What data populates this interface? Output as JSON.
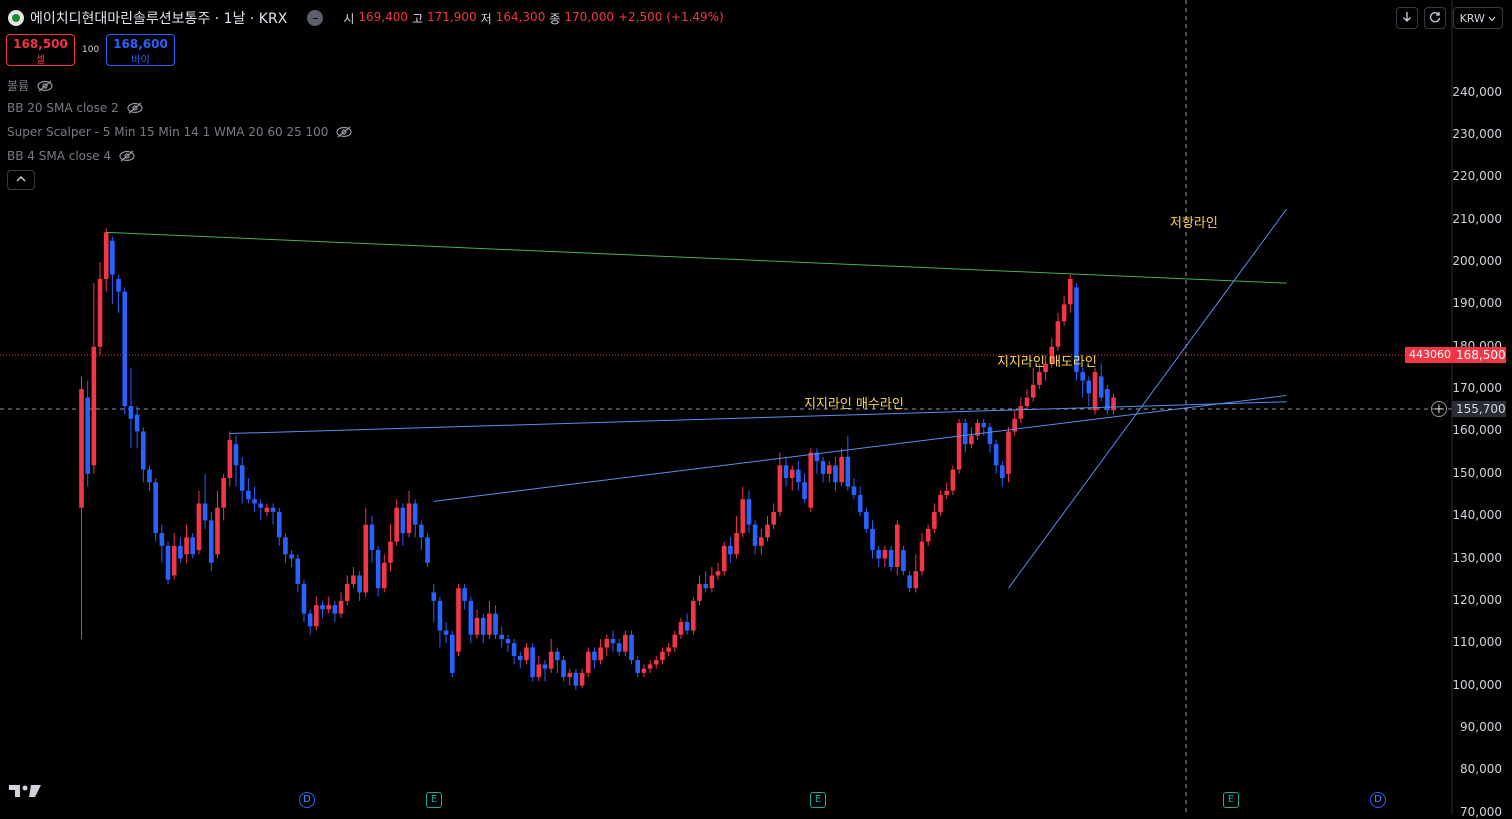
{
  "header": {
    "title": "에이치디현대마린솔루션보통주 · 1날 · KRX",
    "ohlc": [
      {
        "k": "시",
        "v": "169,400"
      },
      {
        "k": "고",
        "v": "171,900"
      },
      {
        "k": "저",
        "v": "164,300"
      },
      {
        "k": "종",
        "v": "170,000"
      },
      {
        "k": "",
        "v": "+2,500 (+1.49%)"
      }
    ]
  },
  "trade": {
    "sell_price": "168,500",
    "sell_label": "셀",
    "qty": "100",
    "buy_price": "168,600",
    "buy_label": "바이"
  },
  "indicators": [
    {
      "label": "볼륨"
    },
    {
      "label": "BB 20 SMA close 2"
    },
    {
      "label": "Super Scalper - 5 Min 15 Min 14 1 WMA 20 60 25 100"
    },
    {
      "label": "BB 4 SMA close 4"
    }
  ],
  "toolbar": {
    "currency": "KRW"
  },
  "axis": {
    "labels": [
      "240,000",
      "230,000",
      "220,000",
      "210,000",
      "200,000",
      "190,000",
      "180,000",
      "170,000",
      "160,000",
      "150,000",
      "140,000",
      "130,000",
      "120,000",
      "110,000",
      "100,000",
      "90,000",
      "80,000",
      "70,000"
    ],
    "current_price": "168,500",
    "countdown": "443060",
    "crosshair_price": "155,700"
  },
  "annotations": {
    "resistance": "저항라인",
    "support_sell": "지지라인 매도라인",
    "support_buy": "지지라인 매수라인"
  },
  "events": [
    {
      "type": "D",
      "label": "D"
    },
    {
      "type": "E",
      "label": "E"
    },
    {
      "type": "E",
      "label": "E"
    },
    {
      "type": "E",
      "label": "E"
    },
    {
      "type": "D",
      "label": "D"
    }
  ],
  "colors": {
    "up": "#f23645",
    "down": "#2962ff",
    "resistance_line": "#4caf50",
    "trend_line": "#5b8def",
    "annotation": "#ffd54f"
  },
  "chart_data": {
    "type": "candlestick",
    "ylim": [
      65000,
      245000
    ],
    "candles": [
      {
        "o": 142000,
        "c": 170000,
        "h": 173000,
        "l": 111000
      },
      {
        "o": 168000,
        "c": 150000,
        "h": 172000,
        "l": 147000
      },
      {
        "o": 152000,
        "c": 180000,
        "h": 195000,
        "l": 150000
      },
      {
        "o": 180000,
        "c": 196000,
        "h": 200000,
        "l": 178000
      },
      {
        "o": 196000,
        "c": 207000,
        "h": 208000,
        "l": 193000
      },
      {
        "o": 205000,
        "c": 197000,
        "h": 206000,
        "l": 190000
      },
      {
        "o": 196000,
        "c": 193000,
        "h": 197000,
        "l": 188000
      },
      {
        "o": 193000,
        "c": 166000,
        "h": 194000,
        "l": 164000
      },
      {
        "o": 166000,
        "c": 163000,
        "h": 175000,
        "l": 156000
      },
      {
        "o": 164000,
        "c": 160000,
        "h": 166000,
        "l": 156000
      },
      {
        "o": 160000,
        "c": 151000,
        "h": 161000,
        "l": 148000
      },
      {
        "o": 151000,
        "c": 148000,
        "h": 152000,
        "l": 146000
      },
      {
        "o": 148000,
        "c": 136000,
        "h": 149000,
        "l": 134000
      },
      {
        "o": 136000,
        "c": 133000,
        "h": 138000,
        "l": 129000
      },
      {
        "o": 133000,
        "c": 125000,
        "h": 134000,
        "l": 124000
      },
      {
        "o": 126000,
        "c": 133000,
        "h": 136000,
        "l": 125000
      },
      {
        "o": 133000,
        "c": 130000,
        "h": 135000,
        "l": 129000
      },
      {
        "o": 131000,
        "c": 135000,
        "h": 138000,
        "l": 129000
      },
      {
        "o": 135000,
        "c": 131000,
        "h": 136000,
        "l": 130000
      },
      {
        "o": 132000,
        "c": 143000,
        "h": 146000,
        "l": 131000
      },
      {
        "o": 143000,
        "c": 139000,
        "h": 150000,
        "l": 137000
      },
      {
        "o": 139000,
        "c": 129000,
        "h": 141000,
        "l": 127000
      },
      {
        "o": 131000,
        "c": 142000,
        "h": 146000,
        "l": 130000
      },
      {
        "o": 142000,
        "c": 149000,
        "h": 150000,
        "l": 139000
      },
      {
        "o": 149000,
        "c": 158000,
        "h": 160000,
        "l": 147000
      },
      {
        "o": 157000,
        "c": 152000,
        "h": 159000,
        "l": 147000
      },
      {
        "o": 152000,
        "c": 146000,
        "h": 154000,
        "l": 143000
      },
      {
        "o": 146000,
        "c": 144000,
        "h": 149000,
        "l": 143000
      },
      {
        "o": 144000,
        "c": 143000,
        "h": 147000,
        "l": 141000
      },
      {
        "o": 143000,
        "c": 142000,
        "h": 144000,
        "l": 139000
      },
      {
        "o": 141000,
        "c": 142000,
        "h": 143000,
        "l": 140000
      },
      {
        "o": 142000,
        "c": 141000,
        "h": 143000,
        "l": 138000
      },
      {
        "o": 141000,
        "c": 135000,
        "h": 142000,
        "l": 133000
      },
      {
        "o": 135000,
        "c": 131000,
        "h": 136000,
        "l": 129000
      },
      {
        "o": 131000,
        "c": 130000,
        "h": 132000,
        "l": 128000
      },
      {
        "o": 130000,
        "c": 124000,
        "h": 131000,
        "l": 122000
      },
      {
        "o": 124000,
        "c": 117000,
        "h": 125000,
        "l": 115000
      },
      {
        "o": 117000,
        "c": 114000,
        "h": 118000,
        "l": 112000
      },
      {
        "o": 114000,
        "c": 119000,
        "h": 121000,
        "l": 113000
      },
      {
        "o": 119000,
        "c": 118000,
        "h": 120000,
        "l": 116000
      },
      {
        "o": 118000,
        "c": 119000,
        "h": 121000,
        "l": 117000
      },
      {
        "o": 119000,
        "c": 117000,
        "h": 120000,
        "l": 115000
      },
      {
        "o": 117000,
        "c": 120000,
        "h": 122000,
        "l": 116000
      },
      {
        "o": 120000,
        "c": 124000,
        "h": 126000,
        "l": 119000
      },
      {
        "o": 124000,
        "c": 126000,
        "h": 128000,
        "l": 123000
      },
      {
        "o": 126000,
        "c": 122000,
        "h": 127000,
        "l": 120000
      },
      {
        "o": 122000,
        "c": 138000,
        "h": 142000,
        "l": 121000
      },
      {
        "o": 138000,
        "c": 132000,
        "h": 140000,
        "l": 129000
      },
      {
        "o": 132000,
        "c": 123000,
        "h": 133000,
        "l": 121000
      },
      {
        "o": 123000,
        "c": 129000,
        "h": 131000,
        "l": 122000
      },
      {
        "o": 129000,
        "c": 134000,
        "h": 138000,
        "l": 127000
      },
      {
        "o": 134000,
        "c": 142000,
        "h": 144000,
        "l": 133000
      },
      {
        "o": 142000,
        "c": 136000,
        "h": 143000,
        "l": 133000
      },
      {
        "o": 136000,
        "c": 143000,
        "h": 146000,
        "l": 135000
      },
      {
        "o": 143000,
        "c": 138000,
        "h": 144000,
        "l": 135000
      },
      {
        "o": 138000,
        "c": 135000,
        "h": 139000,
        "l": 132000
      },
      {
        "o": 135000,
        "c": 129000,
        "h": 136000,
        "l": 128000
      },
      {
        "o": 122000,
        "c": 120000,
        "h": 124000,
        "l": 115000
      },
      {
        "o": 120000,
        "c": 113000,
        "h": 121000,
        "l": 109000
      },
      {
        "o": 113000,
        "c": 112000,
        "h": 115000,
        "l": 110000
      },
      {
        "o": 112000,
        "c": 103000,
        "h": 113000,
        "l": 102000
      },
      {
        "o": 108000,
        "c": 123000,
        "h": 124000,
        "l": 107000
      },
      {
        "o": 123000,
        "c": 120000,
        "h": 124000,
        "l": 118000
      },
      {
        "o": 120000,
        "c": 112000,
        "h": 121000,
        "l": 110000
      },
      {
        "o": 112000,
        "c": 116000,
        "h": 118000,
        "l": 111000
      },
      {
        "o": 116000,
        "c": 112000,
        "h": 117000,
        "l": 110000
      },
      {
        "o": 112000,
        "c": 117000,
        "h": 120000,
        "l": 111000
      },
      {
        "o": 117000,
        "c": 112000,
        "h": 119000,
        "l": 111000
      },
      {
        "o": 112000,
        "c": 111000,
        "h": 114000,
        "l": 109000
      },
      {
        "o": 111000,
        "c": 110000,
        "h": 112000,
        "l": 108000
      },
      {
        "o": 110000,
        "c": 107000,
        "h": 111000,
        "l": 105000
      },
      {
        "o": 107000,
        "c": 106000,
        "h": 108000,
        "l": 104000
      },
      {
        "o": 106000,
        "c": 109000,
        "h": 110000,
        "l": 105000
      },
      {
        "o": 109000,
        "c": 102000,
        "h": 110000,
        "l": 101000
      },
      {
        "o": 102000,
        "c": 105000,
        "h": 107000,
        "l": 101000
      },
      {
        "o": 105000,
        "c": 104000,
        "h": 106000,
        "l": 101000
      },
      {
        "o": 104000,
        "c": 108000,
        "h": 111000,
        "l": 103000
      },
      {
        "o": 108000,
        "c": 106000,
        "h": 109000,
        "l": 103000
      },
      {
        "o": 106000,
        "c": 102000,
        "h": 107000,
        "l": 101000
      },
      {
        "o": 102000,
        "c": 103000,
        "h": 104000,
        "l": 100000
      },
      {
        "o": 103000,
        "c": 100000,
        "h": 104000,
        "l": 99000
      },
      {
        "o": 100000,
        "c": 103000,
        "h": 104000,
        "l": 99500
      },
      {
        "o": 103000,
        "c": 108000,
        "h": 109000,
        "l": 102000
      },
      {
        "o": 108000,
        "c": 106000,
        "h": 109000,
        "l": 104000
      },
      {
        "o": 106000,
        "c": 109000,
        "h": 111000,
        "l": 105000
      },
      {
        "o": 109000,
        "c": 111000,
        "h": 112000,
        "l": 107000
      },
      {
        "o": 111000,
        "c": 110000,
        "h": 113000,
        "l": 108000
      },
      {
        "o": 110000,
        "c": 108000,
        "h": 111000,
        "l": 107000
      },
      {
        "o": 108000,
        "c": 112000,
        "h": 113000,
        "l": 107000
      },
      {
        "o": 112000,
        "c": 106000,
        "h": 113000,
        "l": 105000
      },
      {
        "o": 106000,
        "c": 103000,
        "h": 107000,
        "l": 102000
      },
      {
        "o": 103000,
        "c": 104000,
        "h": 105000,
        "l": 102000
      },
      {
        "o": 104000,
        "c": 105000,
        "h": 106000,
        "l": 103000
      },
      {
        "o": 105000,
        "c": 106000,
        "h": 107000,
        "l": 104000
      },
      {
        "o": 106000,
        "c": 108000,
        "h": 109000,
        "l": 105000
      },
      {
        "o": 108000,
        "c": 109000,
        "h": 110000,
        "l": 107000
      },
      {
        "o": 109000,
        "c": 112000,
        "h": 113000,
        "l": 108000
      },
      {
        "o": 112000,
        "c": 115000,
        "h": 116000,
        "l": 111000
      },
      {
        "o": 115000,
        "c": 113000,
        "h": 117000,
        "l": 112000
      },
      {
        "o": 113000,
        "c": 120000,
        "h": 121000,
        "l": 112000
      },
      {
        "o": 120000,
        "c": 124000,
        "h": 126000,
        "l": 119000
      },
      {
        "o": 124000,
        "c": 123000,
        "h": 127000,
        "l": 122000
      },
      {
        "o": 123000,
        "c": 126000,
        "h": 128000,
        "l": 122000
      },
      {
        "o": 126000,
        "c": 127000,
        "h": 129000,
        "l": 125000
      },
      {
        "o": 127000,
        "c": 133000,
        "h": 134000,
        "l": 126000
      },
      {
        "o": 133000,
        "c": 131000,
        "h": 135000,
        "l": 129000
      },
      {
        "o": 131000,
        "c": 136000,
        "h": 140000,
        "l": 130000
      },
      {
        "o": 136000,
        "c": 144000,
        "h": 147000,
        "l": 135000
      },
      {
        "o": 144000,
        "c": 138000,
        "h": 146000,
        "l": 136000
      },
      {
        "o": 138000,
        "c": 133000,
        "h": 139000,
        "l": 131000
      },
      {
        "o": 133000,
        "c": 135000,
        "h": 137000,
        "l": 131000
      },
      {
        "o": 135000,
        "c": 138000,
        "h": 140000,
        "l": 134000
      },
      {
        "o": 138000,
        "c": 141000,
        "h": 143000,
        "l": 137000
      },
      {
        "o": 141000,
        "c": 152000,
        "h": 155000,
        "l": 140000
      },
      {
        "o": 152000,
        "c": 149000,
        "h": 154000,
        "l": 147000
      },
      {
        "o": 149000,
        "c": 151000,
        "h": 152000,
        "l": 146000
      },
      {
        "o": 151000,
        "c": 148000,
        "h": 153000,
        "l": 146000
      },
      {
        "o": 148000,
        "c": 144000,
        "h": 150000,
        "l": 143000
      },
      {
        "o": 142000,
        "c": 155000,
        "h": 156000,
        "l": 141000
      },
      {
        "o": 155000,
        "c": 153000,
        "h": 156000,
        "l": 150000
      },
      {
        "o": 153000,
        "c": 150000,
        "h": 154000,
        "l": 148000
      },
      {
        "o": 150000,
        "c": 152000,
        "h": 153000,
        "l": 148000
      },
      {
        "o": 152000,
        "c": 148000,
        "h": 154000,
        "l": 146000
      },
      {
        "o": 148000,
        "c": 154000,
        "h": 156000,
        "l": 147000
      },
      {
        "o": 154000,
        "c": 147000,
        "h": 159000,
        "l": 146000
      },
      {
        "o": 147000,
        "c": 145000,
        "h": 149000,
        "l": 144000
      },
      {
        "o": 145000,
        "c": 141000,
        "h": 147000,
        "l": 140000
      },
      {
        "o": 141000,
        "c": 137000,
        "h": 142000,
        "l": 136000
      },
      {
        "o": 137000,
        "c": 132000,
        "h": 139000,
        "l": 130000
      },
      {
        "o": 132000,
        "c": 130000,
        "h": 133000,
        "l": 128000
      },
      {
        "o": 130000,
        "c": 132000,
        "h": 133000,
        "l": 128000
      },
      {
        "o": 132000,
        "c": 128000,
        "h": 133000,
        "l": 127000
      },
      {
        "o": 128000,
        "c": 138000,
        "h": 139000,
        "l": 126000
      },
      {
        "o": 132000,
        "c": 127000,
        "h": 133000,
        "l": 126000
      },
      {
        "o": 126000,
        "c": 123000,
        "h": 127000,
        "l": 122000
      },
      {
        "o": 123000,
        "c": 127000,
        "h": 131000,
        "l": 122000
      },
      {
        "o": 127000,
        "c": 134000,
        "h": 136000,
        "l": 126000
      },
      {
        "o": 134000,
        "c": 137000,
        "h": 138000,
        "l": 133000
      },
      {
        "o": 137000,
        "c": 141000,
        "h": 143000,
        "l": 136000
      },
      {
        "o": 141000,
        "c": 145000,
        "h": 146000,
        "l": 140000
      },
      {
        "o": 145000,
        "c": 146000,
        "h": 148000,
        "l": 144000
      },
      {
        "o": 146000,
        "c": 151000,
        "h": 152000,
        "l": 145000
      },
      {
        "o": 151000,
        "c": 162000,
        "h": 163000,
        "l": 150000
      },
      {
        "o": 162000,
        "c": 157000,
        "h": 163000,
        "l": 155000
      },
      {
        "o": 157000,
        "c": 159000,
        "h": 161000,
        "l": 156000
      },
      {
        "o": 159000,
        "c": 162000,
        "h": 163000,
        "l": 158000
      },
      {
        "o": 162000,
        "c": 161000,
        "h": 163000,
        "l": 159000
      },
      {
        "o": 161000,
        "c": 157000,
        "h": 162000,
        "l": 155000
      },
      {
        "o": 157000,
        "c": 152000,
        "h": 158000,
        "l": 150000
      },
      {
        "o": 152000,
        "c": 149000,
        "h": 153000,
        "l": 147000
      },
      {
        "o": 150000,
        "c": 160000,
        "h": 161000,
        "l": 148000
      },
      {
        "o": 160000,
        "c": 163000,
        "h": 165000,
        "l": 159000
      },
      {
        "o": 163000,
        "c": 166000,
        "h": 168000,
        "l": 162000
      },
      {
        "o": 166000,
        "c": 168000,
        "h": 170000,
        "l": 165000
      },
      {
        "o": 168000,
        "c": 171000,
        "h": 175000,
        "l": 167000
      },
      {
        "o": 171000,
        "c": 174000,
        "h": 176000,
        "l": 170000
      },
      {
        "o": 174000,
        "c": 176000,
        "h": 178000,
        "l": 172000
      },
      {
        "o": 176000,
        "c": 180000,
        "h": 182000,
        "l": 175000
      },
      {
        "o": 180000,
        "c": 186000,
        "h": 188000,
        "l": 179000
      },
      {
        "o": 186000,
        "c": 190000,
        "h": 192000,
        "l": 185000
      },
      {
        "o": 190000,
        "c": 196000,
        "h": 197000,
        "l": 188000
      },
      {
        "o": 194000,
        "c": 174000,
        "h": 195000,
        "l": 172000
      },
      {
        "o": 174000,
        "c": 172000,
        "h": 175000,
        "l": 168000
      },
      {
        "o": 172000,
        "c": 169000,
        "h": 173000,
        "l": 166000
      },
      {
        "o": 165000,
        "c": 174000,
        "h": 175000,
        "l": 164000
      },
      {
        "o": 173000,
        "c": 168000,
        "h": 176000,
        "l": 167000
      },
      {
        "o": 170000,
        "c": 165000,
        "h": 171000,
        "l": 164000
      },
      {
        "o": 165000,
        "c": 168000,
        "h": 169000,
        "l": 164000
      }
    ],
    "lines": [
      {
        "name": "resistance",
        "from": [
          4,
          207000
        ],
        "to": [
          195,
          195000
        ]
      },
      {
        "name": "support_sell",
        "from": [
          24,
          159500
        ],
        "to": [
          195,
          167000
        ]
      },
      {
        "name": "support_buy",
        "from": [
          57,
          143500
        ],
        "to": [
          195,
          168500
        ]
      },
      {
        "name": "uptrend",
        "from": [
          150,
          123000
        ],
        "to": [
          195,
          212500
        ]
      }
    ]
  }
}
